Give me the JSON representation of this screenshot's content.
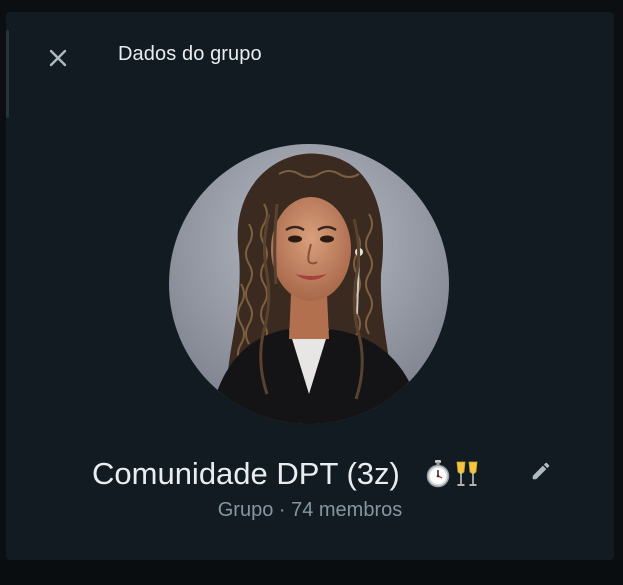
{
  "header": {
    "title": "Dados do grupo",
    "close_icon": "close-icon"
  },
  "group": {
    "name": "Comunidade DPT (3z)",
    "emojis": [
      "stopwatch-emoji",
      "champagne-glasses-emoji"
    ],
    "subtitle": "Grupo · 74 membros",
    "avatar": "group-avatar-photo",
    "edit_icon": "pencil-icon"
  },
  "colors": {
    "panel_bg": "#111b21",
    "text_primary": "#e9edef",
    "text_secondary": "#8696a0",
    "icon": "#aebac1"
  }
}
